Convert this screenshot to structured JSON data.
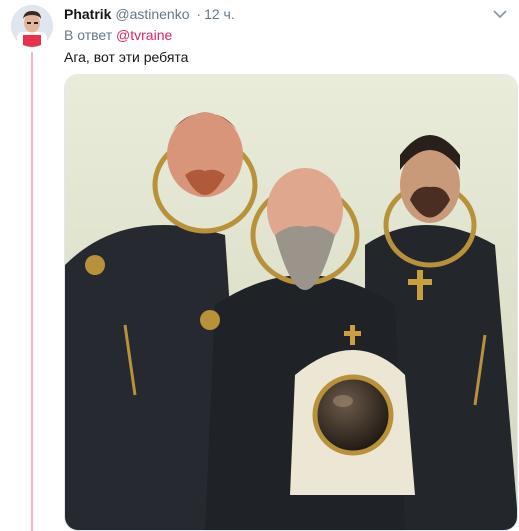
{
  "tweet": {
    "author_name": "Phatrik",
    "author_handle": "@astinenko",
    "separator": "·",
    "time": "12 ч.",
    "reply_prefix": "В ответ",
    "reply_mention": "@tvraine",
    "text": "Ага, вот эти ребята"
  },
  "media": {
    "icon": "image-icon",
    "subject": "painting"
  },
  "colors": {
    "thread_line": "#f5b5c8",
    "mention": "#e0245e",
    "secondary_text": "#657786",
    "primary_text": "#14171a"
  }
}
